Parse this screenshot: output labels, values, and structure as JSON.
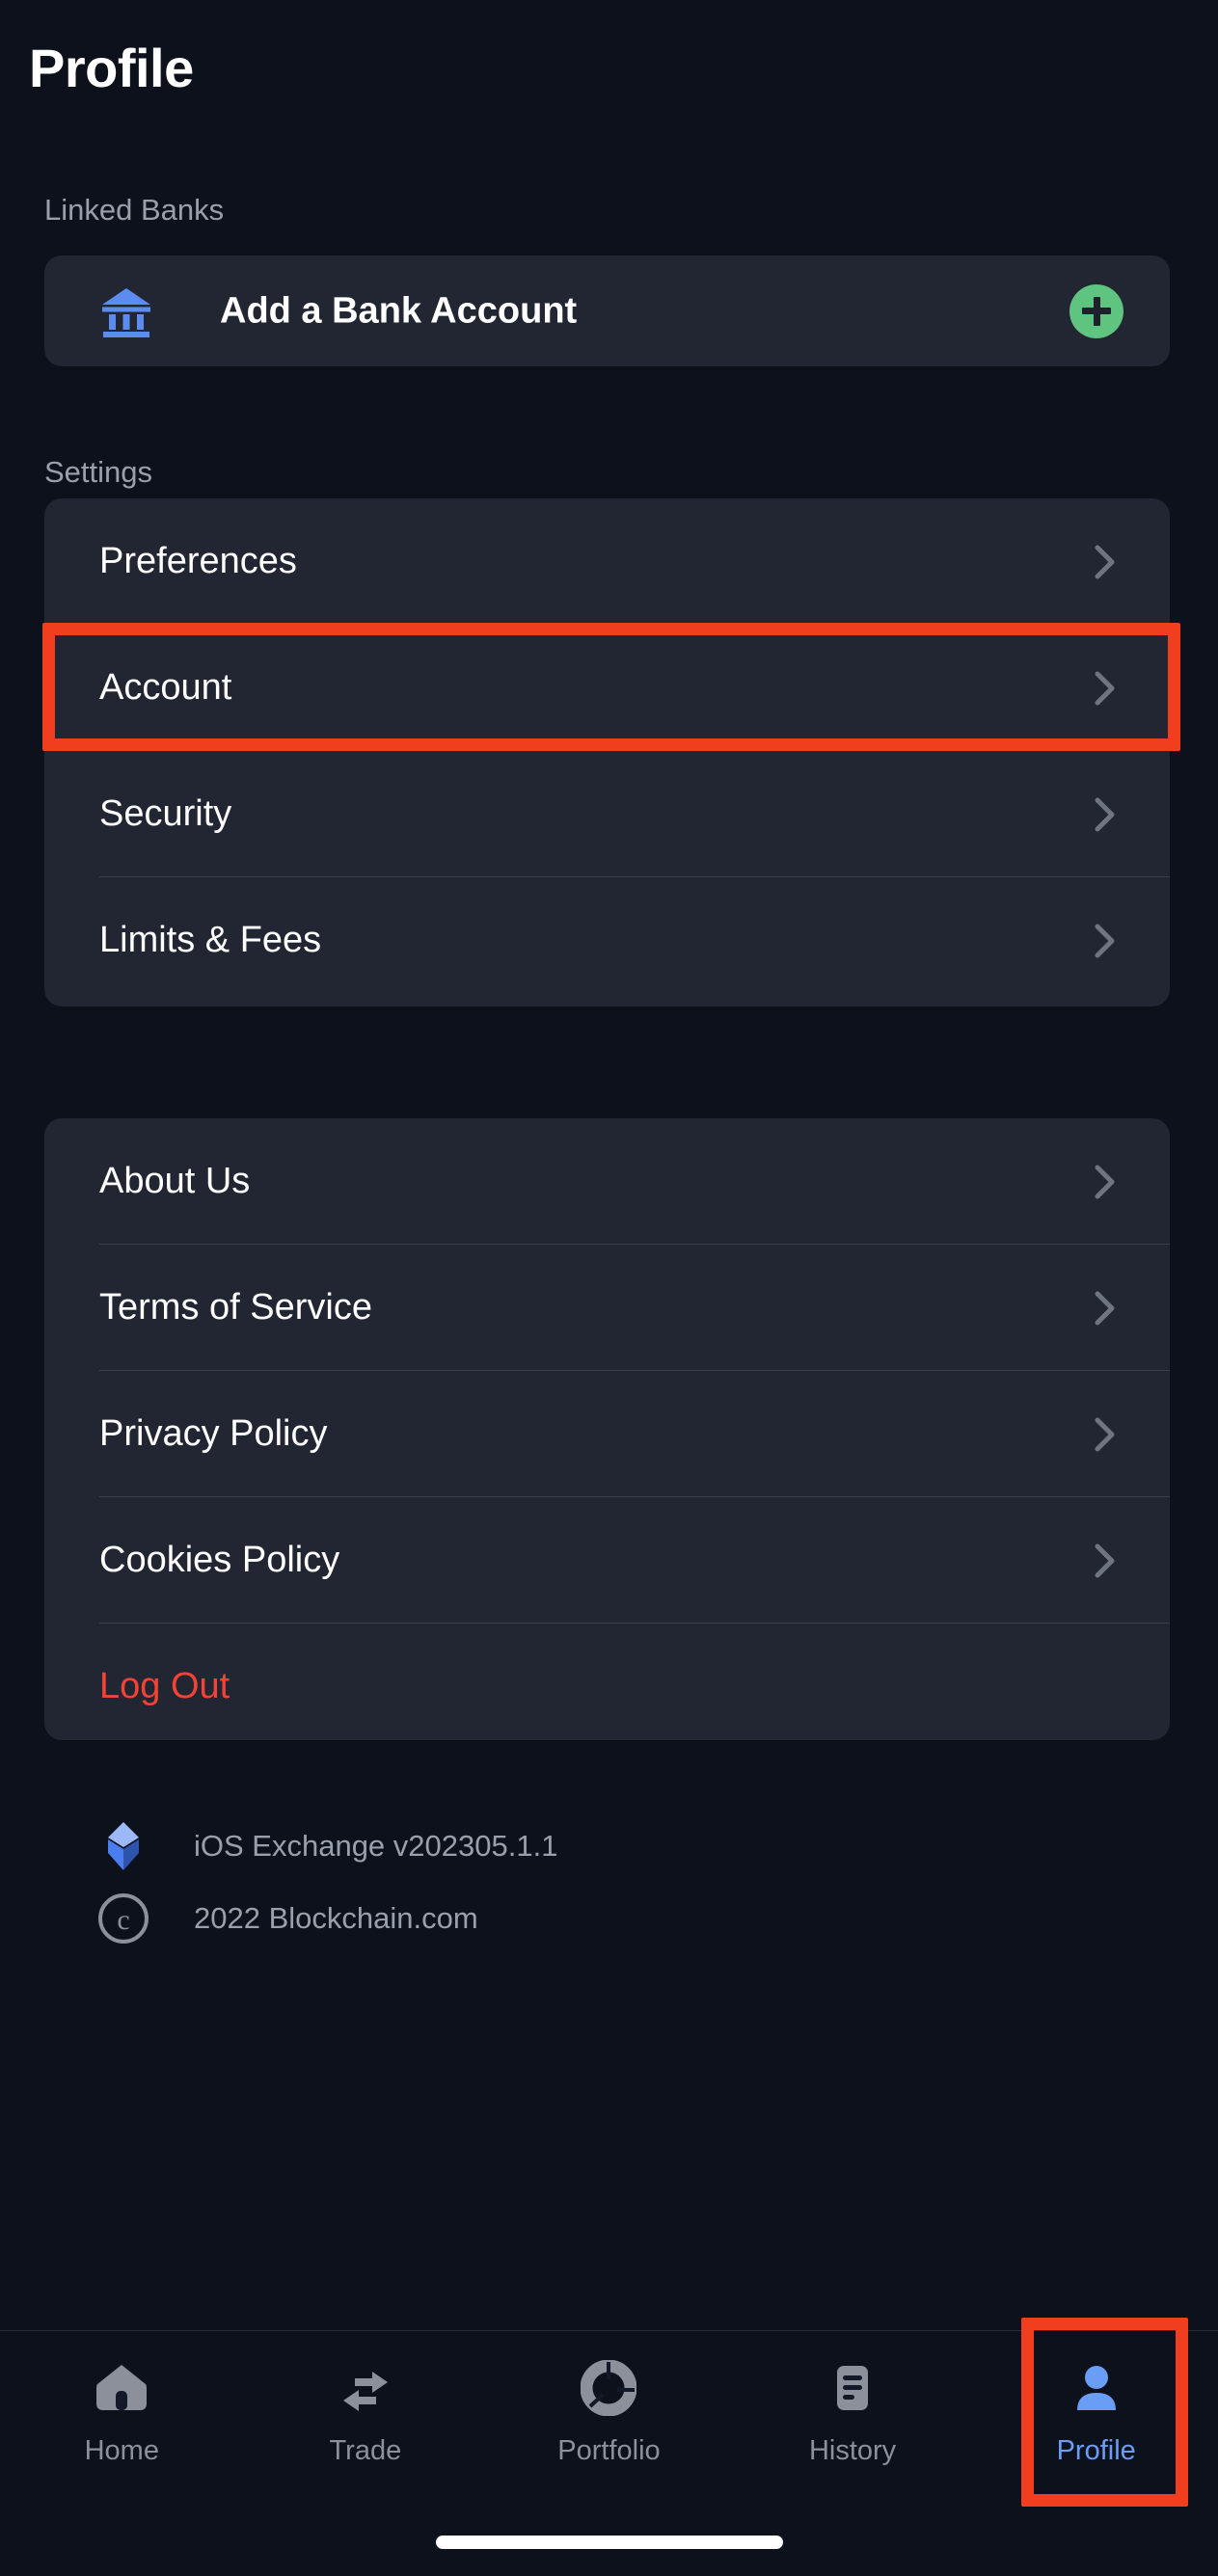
{
  "header": {
    "title": "Profile"
  },
  "sections": {
    "linked_banks": {
      "label": "Linked Banks",
      "bank_row": {
        "icon": "bank-icon",
        "label": "Add a Bank Account",
        "action_icon": "plus-icon"
      }
    },
    "settings": {
      "label": "Settings",
      "items": [
        {
          "label": "Preferences",
          "chevron": "chevron-right-icon"
        },
        {
          "label": "Account",
          "chevron": "chevron-right-icon"
        },
        {
          "label": "Security",
          "chevron": "chevron-right-icon"
        },
        {
          "label": "Limits & Fees",
          "chevron": "chevron-right-icon"
        }
      ]
    },
    "legal": {
      "items": [
        {
          "label": "About Us",
          "chevron": "chevron-right-icon"
        },
        {
          "label": "Terms of Service",
          "chevron": "chevron-right-icon"
        },
        {
          "label": "Privacy Policy",
          "chevron": "chevron-right-icon"
        },
        {
          "label": "Cookies Policy",
          "chevron": "chevron-right-icon"
        },
        {
          "label": "Log Out",
          "chevron": ""
        }
      ]
    }
  },
  "footer": {
    "version": {
      "icon": "blockchain-logo-icon",
      "text": "iOS Exchange v202305.1.1"
    },
    "copyright": {
      "icon": "copyright-icon",
      "text": "2022 Blockchain.com"
    }
  },
  "tabbar": {
    "tabs": [
      {
        "label": "Home",
        "icon": "home-icon",
        "active": false
      },
      {
        "label": "Trade",
        "icon": "swap-arrows-icon",
        "active": false
      },
      {
        "label": "Portfolio",
        "icon": "donut-chart-icon",
        "active": false
      },
      {
        "label": "History",
        "icon": "document-lines-icon",
        "active": false
      },
      {
        "label": "Profile",
        "icon": "person-icon",
        "active": true
      }
    ]
  },
  "colors": {
    "background": "#0d111c",
    "card": "#222632",
    "accent_blue": "#6a9df5",
    "bank_icon_blue": "#5c8cf0",
    "plus_green": "#5ec47f",
    "danger_red": "#f44336",
    "highlight_red": "#f03e1e",
    "muted_text": "#9aa0ab",
    "tab_inactive": "#8b909b",
    "divider": "#3a3f4c"
  }
}
